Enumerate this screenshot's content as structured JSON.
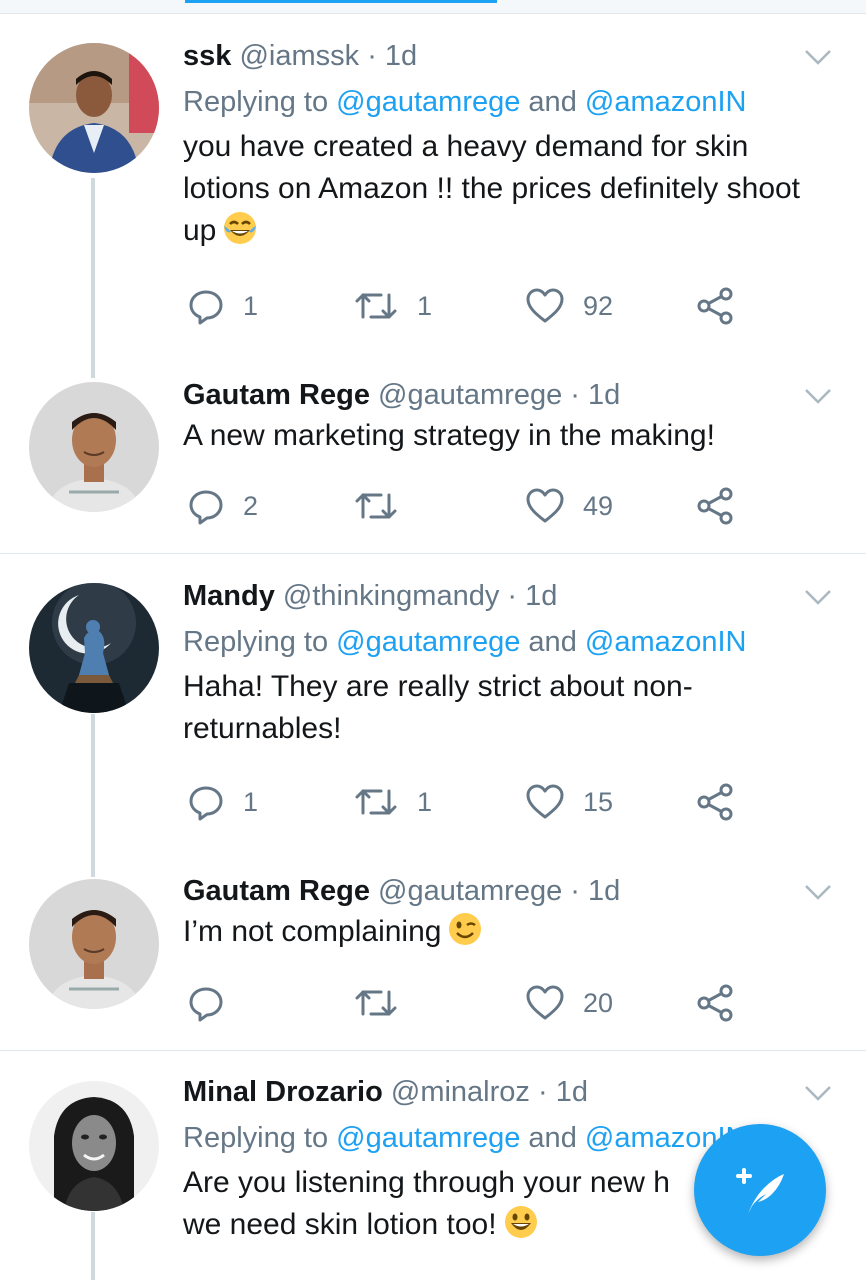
{
  "tweets": [
    {
      "name": "ssk",
      "handle": "@iamssk",
      "dot": "·",
      "time": "1d",
      "replying_prefix": "Replying to ",
      "mention1": "@gautamrege",
      "and": " and ",
      "mention2": "@amazonIN",
      "text": "you have created a heavy demand for skin lotions on Amazon !! the prices definitely shoot up",
      "emoji": "face-with-tears-of-joy",
      "reply_count": "1",
      "retweet_count": "1",
      "like_count": "92"
    },
    {
      "name": "Gautam Rege",
      "handle": "@gautamrege",
      "dot": "·",
      "time": "1d",
      "text": "A new marketing strategy in the making!",
      "reply_count": "2",
      "retweet_count": "",
      "like_count": "49"
    },
    {
      "name": "Mandy",
      "handle": "@thinkingmandy",
      "dot": "·",
      "time": "1d",
      "replying_prefix": "Replying to ",
      "mention1": "@gautamrege",
      "and": " and ",
      "mention2": "@amazonIN",
      "text": "Haha! They are really strict about non-returnables!",
      "reply_count": "1",
      "retweet_count": "1",
      "like_count": "15"
    },
    {
      "name": "Gautam Rege",
      "handle": "@gautamrege",
      "dot": "·",
      "time": "1d",
      "text": "I’m not complaining",
      "emoji": "winking-face",
      "reply_count": "",
      "retweet_count": "",
      "like_count": "20"
    },
    {
      "name": "Minal Drozario",
      "handle": "@minalroz",
      "dot": "·",
      "time": "1d",
      "replying_prefix": "Replying to ",
      "mention1": "@gautamrege",
      "and": " and ",
      "mention2": "@amazonIN",
      "text": "Are you listening through your new h... we need skin lotion too!",
      "text_line1": "Are you listening through your new h",
      "text_line2": "we need skin lotion too!",
      "emoji": "grinning-face"
    }
  ],
  "fab": {
    "icon": "compose-feather-icon",
    "color": "#1da1f2"
  },
  "colors": {
    "accent": "#1da1f2",
    "secondary_text": "#657786",
    "primary_text": "#14171a"
  }
}
